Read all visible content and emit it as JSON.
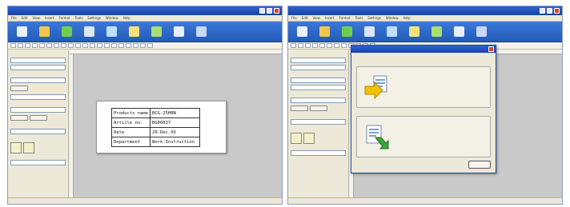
{
  "left_window": {
    "menu": [
      "File",
      "Edit",
      "View",
      "Insert",
      "Format",
      "Tools",
      "Settings",
      "Window",
      "Help"
    ],
    "toolbar": [
      {
        "icon": "new-icon",
        "color": "#e9f2ff"
      },
      {
        "icon": "open-icon",
        "color": "#f2c84b"
      },
      {
        "icon": "print-icon",
        "color": "#6fcf4d"
      },
      {
        "icon": "cut-icon",
        "color": "#dde6f5"
      },
      {
        "icon": "text-icon",
        "color": "#bfe0ff"
      },
      {
        "icon": "barcode-icon",
        "color": "#f7e27a"
      },
      {
        "icon": "image-icon",
        "color": "#a6e06f"
      },
      {
        "icon": "table-icon",
        "color": "#e8eefc"
      },
      {
        "icon": "database-icon",
        "color": "#c9d8f5"
      }
    ],
    "label_table": [
      {
        "key": "Products name",
        "value": "BCG-25HBN"
      },
      {
        "key": "Article no.",
        "value": "BG00027"
      },
      {
        "key": "Date",
        "value": "20.Dec.XX"
      },
      {
        "key": "Department",
        "value": "Work Instruction"
      }
    ]
  },
  "right_window": {
    "menu": [
      "File",
      "Edit",
      "View",
      "Insert",
      "Format",
      "Tools",
      "Settings",
      "Window",
      "Help"
    ]
  },
  "colors": {
    "titlebar": "#1743a8",
    "toolbar": "#245bb8",
    "canvas": "#c9c9c9",
    "dialog_bg": "#ece9d8",
    "close_button": "#d8472a"
  }
}
